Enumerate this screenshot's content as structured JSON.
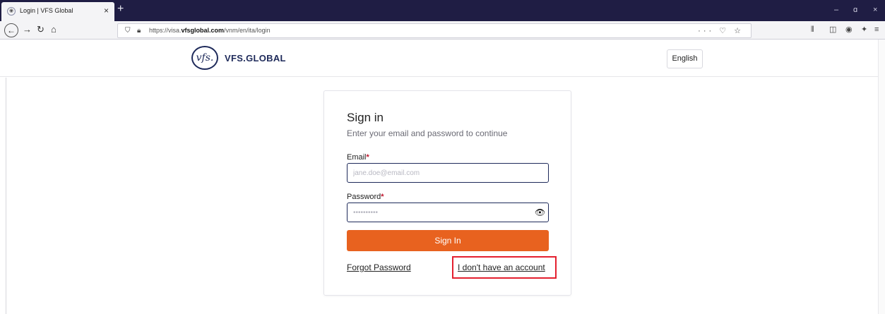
{
  "browser": {
    "tab_title": "Login | VFS Global",
    "tab_close": "×",
    "new_tab": "+",
    "window_controls": [
      "–",
      "ɑ",
      "×"
    ],
    "url_scheme": "https://visa.",
    "url_domain": "vfsglobal.com",
    "url_path": "/vnm/en/ita/login",
    "url_actions": "··· ♡ ☆"
  },
  "site": {
    "logo_mark": "vfs.",
    "logo_text": "VFS.GLOBAL",
    "language_button": "English"
  },
  "login": {
    "title": "Sign in",
    "subtitle": "Enter your email and password to continue",
    "email_label": "Email",
    "required_mark": "*",
    "email_placeholder": "jane.doe@email.com",
    "password_label": "Password",
    "password_placeholder": "••••••••••",
    "submit_label": "Sign In",
    "forgot_password": "Forgot Password",
    "no_account": "I don't have an account"
  },
  "colors": {
    "tab_strip": "#1f1d44",
    "brand_navy": "#1e2a5a",
    "accent_orange": "#e8621f",
    "required_red": "#c0172e",
    "highlight_red": "#e4202f"
  }
}
